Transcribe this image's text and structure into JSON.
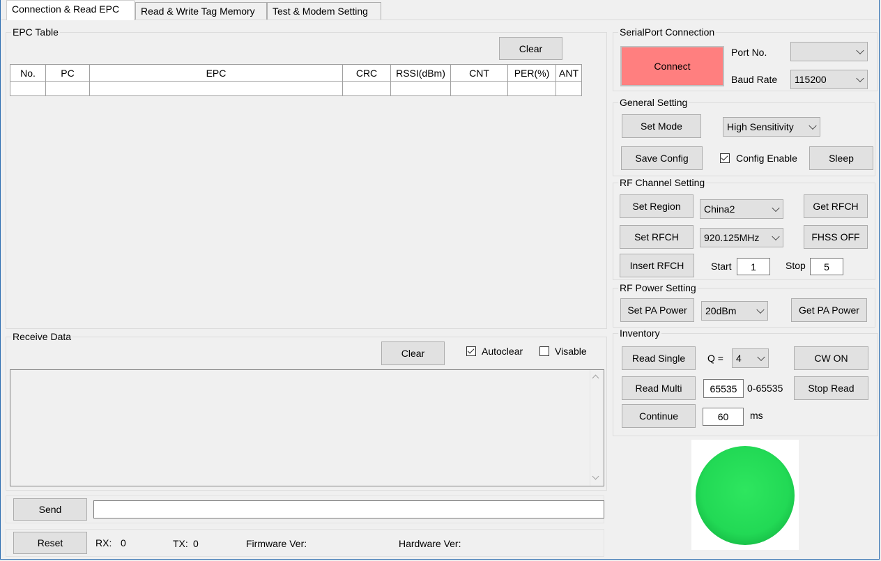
{
  "tabs": [
    "Connection & Read EPC",
    "Read & Write Tag Memory",
    "Test & Modem Setting"
  ],
  "epc_table": {
    "title": "EPC Table",
    "clear_label": "Clear",
    "columns": [
      "No.",
      "PC",
      "EPC",
      "CRC",
      "RSSI(dBm)",
      "CNT",
      "PER(%)",
      "ANT"
    ]
  },
  "receive": {
    "title": "Receive Data",
    "clear_label": "Clear",
    "autoclear_label": "Autoclear",
    "autoclear_checked": true,
    "visable_label": "Visable",
    "visable_checked": false
  },
  "send_label": "Send",
  "reset_label": "Reset",
  "status": {
    "rx_label": "RX:",
    "rx_value": "0",
    "tx_label": "TX:",
    "tx_value": "0",
    "firmware_label": "Firmware Ver:",
    "hardware_label": "Hardware Ver:"
  },
  "serial": {
    "title": "SerialPort Connection",
    "connect_label": "Connect",
    "port_label": "Port No.",
    "port_value": "",
    "baud_label": "Baud Rate",
    "baud_value": "115200"
  },
  "general": {
    "title": "General Setting",
    "set_mode_label": "Set Mode",
    "mode_value": "High Sensitivity",
    "save_config_label": "Save Config",
    "config_enable_label": "Config Enable",
    "config_enable_checked": true,
    "sleep_label": "Sleep"
  },
  "rf_channel": {
    "title": "RF Channel Setting",
    "set_region_label": "Set Region",
    "region_value": "China2",
    "get_rfch_label": "Get RFCH",
    "set_rfch_label": "Set RFCH",
    "rfch_value": "920.125MHz",
    "fhss_label": "FHSS OFF",
    "insert_rfch_label": "Insert RFCH",
    "start_label": "Start",
    "start_value": "1",
    "stop_label": "Stop",
    "stop_value": "5"
  },
  "rf_power": {
    "title": "RF Power Setting",
    "set_pa_label": "Set PA Power",
    "power_value": "20dBm",
    "get_pa_label": "Get PA Power"
  },
  "inventory": {
    "title": "Inventory",
    "read_single_label": "Read Single",
    "q_label": "Q =",
    "q_value": "4",
    "cw_on_label": "CW ON",
    "read_multi_label": "Read Multi",
    "multi_value": "65535",
    "range_label": "0-65535",
    "stop_read_label": "Stop Read",
    "continue_label": "Continue",
    "continue_value": "60",
    "ms_label": "ms"
  },
  "colors": {
    "connect_button": "#ff7f7f",
    "status_indicator": "#22dd55"
  }
}
